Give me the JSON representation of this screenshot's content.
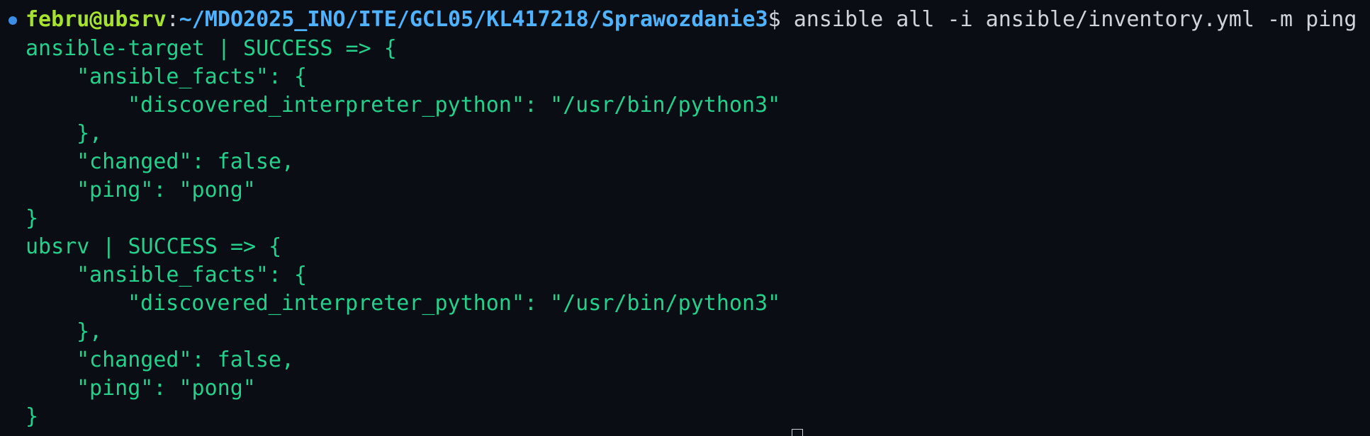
{
  "prompt": {
    "user_host": "febru@ubsrv",
    "separator": ":",
    "path": "~/MDO2025_INO/ITE/GCL05/KL417218/Sprawozdanie3",
    "dollar": "$",
    "command": " ansible all -i ansible/inventory.yml -m ping"
  },
  "output": {
    "lines": [
      "ansible-target | SUCCESS => {",
      "\"ansible_facts\": {",
      "\"discovered_interpreter_python\": \"/usr/bin/python3\"",
      "},",
      "\"changed\": false,",
      "\"ping\": \"pong\"",
      "}",
      "ubsrv | SUCCESS => {",
      "\"ansible_facts\": {",
      "\"discovered_interpreter_python\": \"/usr/bin/python3\"",
      "},",
      "\"changed\": false,",
      "\"ping\": \"pong\"",
      "}"
    ]
  },
  "colors": {
    "background": "#0b0d14",
    "output_text": "#23d18b",
    "user_host": "#a6e22e",
    "path": "#4fb3ff",
    "command": "#cfd3da",
    "status_dot": "#3a8ee6"
  },
  "icons": {
    "status": "status-dot-icon",
    "cursor": "text-cursor-icon"
  }
}
